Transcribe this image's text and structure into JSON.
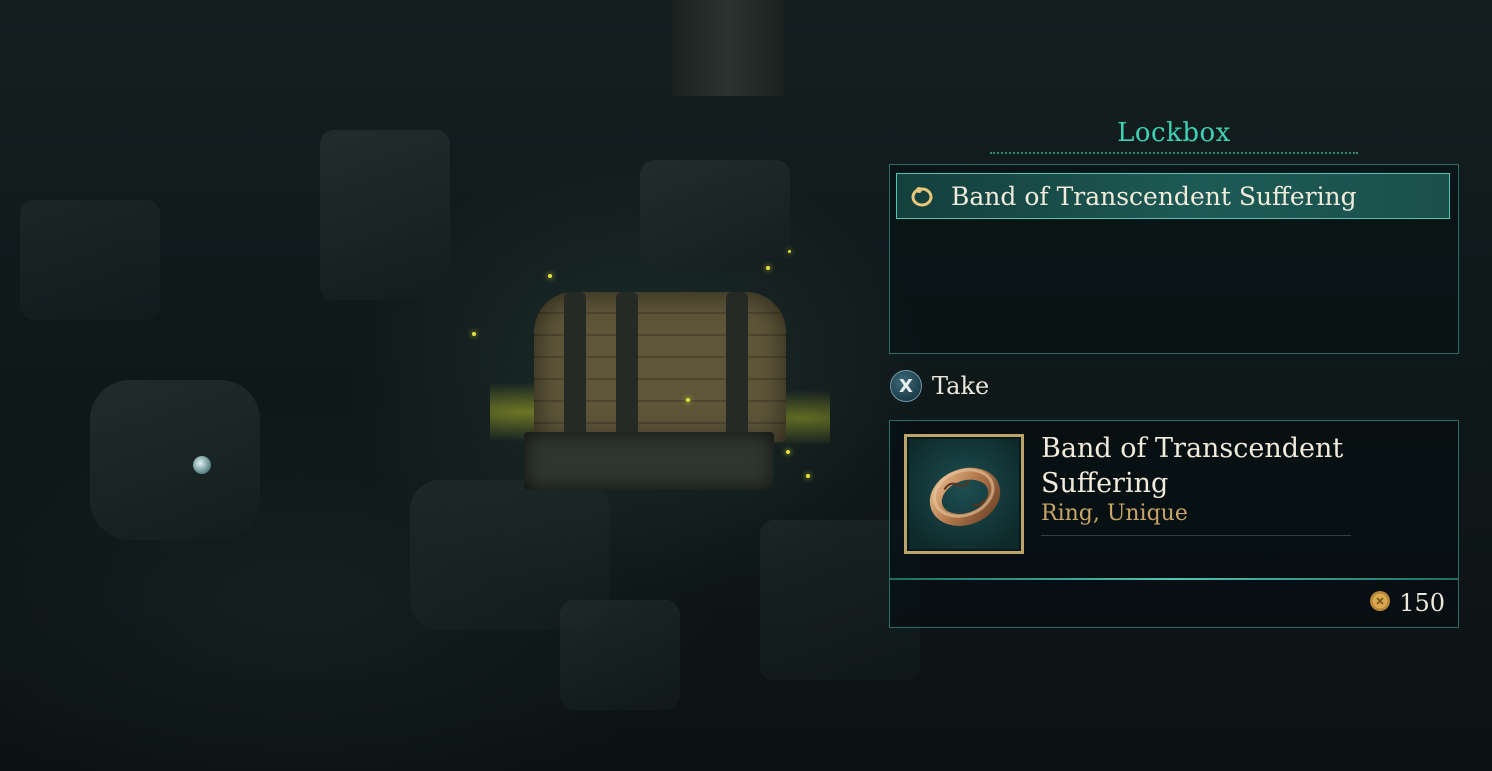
{
  "container": {
    "title": "Lockbox",
    "items": [
      {
        "label": "Band of Transcendent Suffering",
        "icon": "ring-icon",
        "selected": true
      }
    ]
  },
  "prompt": {
    "button_glyph": "X",
    "action_label": "Take"
  },
  "detail": {
    "name_line1": "Band of Transcendent",
    "name_line2": "Suffering",
    "subtitle": "Ring, Unique",
    "image": "ring-icon",
    "price": "150",
    "currency_icon": "gold-coin-icon"
  },
  "colors": {
    "accent": "#3ed2b4",
    "panel_border": "#2a6b63",
    "highlight_border": "#4fc6b1",
    "rarity_text": "#c8a466",
    "text": "#f1ebdc"
  }
}
